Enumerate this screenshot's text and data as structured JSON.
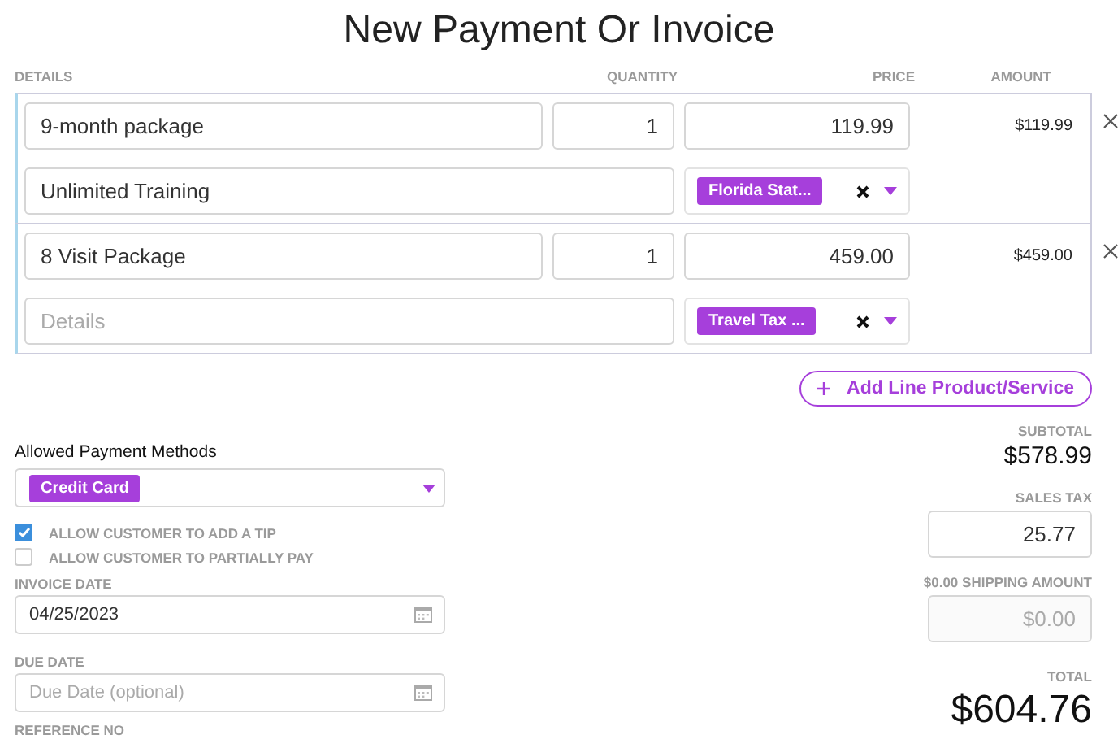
{
  "title": "New Payment Or Invoice",
  "columns": [
    "DETAILS",
    "QUANTITY",
    "PRICE",
    "AMOUNT"
  ],
  "line_items": [
    {
      "name": "9-month package",
      "quantity": "1",
      "price": "119.99",
      "amount": "$119.99",
      "description": {
        "value": "Unlimited Training"
      },
      "tax": "Florida Stat..."
    },
    {
      "name": "8 Visit Package",
      "quantity": "1",
      "price": "459.00",
      "amount": "$459.00",
      "description": {
        "placeholder": "Details"
      },
      "tax": "Travel Tax ..."
    }
  ],
  "add_button": "Add Line Product/Service",
  "payment_methods": {
    "label": "Allowed Payment Methods",
    "tags": [
      "Credit Card"
    ]
  },
  "options": [
    {
      "label": "ALLOW CUSTOMER TO ADD A TIP",
      "checked": true
    },
    {
      "label": "ALLOW CUSTOMER TO PARTIALLY PAY",
      "checked": false
    }
  ],
  "invoice_date": {
    "label": "INVOICE DATE",
    "value": "04/25/2023"
  },
  "due_date": {
    "label": "DUE DATE",
    "placeholder": "Due Date (optional)"
  },
  "reference": {
    "label": "REFERENCE NO"
  },
  "summary": {
    "subtotal_label": "SUBTOTAL",
    "subtotal": "$578.99",
    "sales_tax_label": "SALES TAX",
    "sales_tax": "25.77",
    "shipping_label": "$0.00 SHIPPING AMOUNT",
    "shipping_placeholder": "$0.00",
    "total_label": "TOTAL",
    "total": "$604.76"
  }
}
